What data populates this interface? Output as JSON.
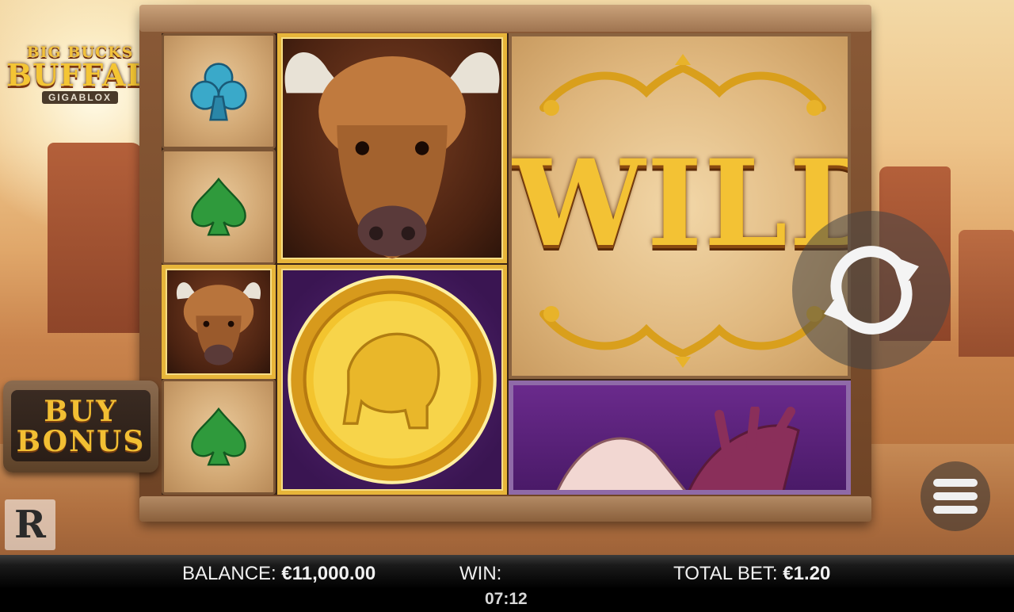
{
  "game": {
    "logo": {
      "line1": "BIG BUCKS",
      "line2": "BUFFALO",
      "line3": "GIGABLOX"
    },
    "buy_bonus": {
      "line1": "BUY",
      "line2": "BONUS"
    },
    "provider_logo": "R"
  },
  "reels": {
    "wild_label": "WILD",
    "symbols": [
      {
        "reel": 1,
        "row": 1,
        "symbol": "club-icon",
        "color": "#3aa9c9"
      },
      {
        "reel": 1,
        "row": 2,
        "symbol": "spade-icon",
        "color": "#2f9a3c"
      },
      {
        "reel": 1,
        "row": 3,
        "symbol": "buffalo-icon"
      },
      {
        "reel": 1,
        "row": 4,
        "symbol": "spade-icon",
        "color": "#2f9a3c"
      },
      {
        "reel": 2,
        "rows": "1-2",
        "symbol": "buffalo-icon",
        "size": "2x2"
      },
      {
        "reel": 2,
        "rows": "3-4",
        "symbol": "gold-coin-icon",
        "size": "2x2"
      },
      {
        "reel": "3-4",
        "rows": "1-3",
        "symbol": "wild-icon",
        "size": "3x3"
      },
      {
        "reel": "3-4",
        "rows": "4",
        "symbol": "antler-icon"
      }
    ]
  },
  "controls": {
    "spin_icon": "refresh-icon",
    "menu_icon": "hamburger-menu-icon"
  },
  "status_bar": {
    "balance_label": "BALANCE:",
    "balance_value": "€11,000.00",
    "win_label": "WIN:",
    "win_value": "",
    "total_bet_label": "TOTAL BET:",
    "total_bet_value": "€1.20",
    "clock": "07:12"
  },
  "colors": {
    "gold": "#f2bf33",
    "bar": "#000000",
    "text": "#f0f0f0"
  }
}
